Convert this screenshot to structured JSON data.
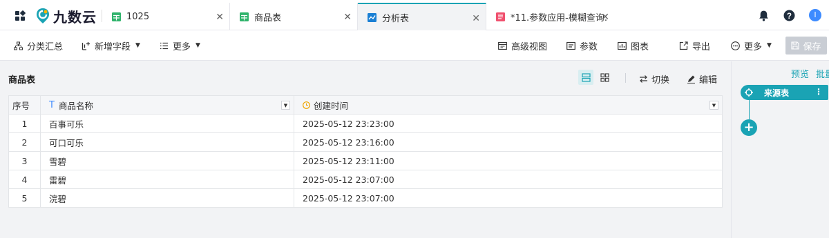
{
  "app": {
    "logo_text": "九数云"
  },
  "tabs": [
    {
      "label": "1025",
      "icon": "spreadsheet-icon",
      "color": "#2fb36b"
    },
    {
      "label": "商品表",
      "icon": "spreadsheet-icon",
      "color": "#2fb36b"
    },
    {
      "label": "分析表",
      "icon": "analysis-icon",
      "color": "#1aa3b4",
      "active": true
    },
    {
      "label": "*11.参数应用-模糊查询...",
      "icon": "document-icon",
      "color": "#f0506e"
    }
  ],
  "user": {
    "avatar_letter": "I"
  },
  "toolbar": {
    "group_summary": "分类汇总",
    "add_field": "新增字段",
    "more_left": "更多",
    "advanced_view": "高级视图",
    "params": "参数",
    "chart": "图表",
    "export": "导出",
    "more_right": "更多",
    "save": "保存"
  },
  "panel": {
    "title": "商品表",
    "switch_label": "切换",
    "edit_label": "编辑"
  },
  "table": {
    "headers": {
      "index": "序号",
      "name": "商品名称",
      "created": "创建时间"
    },
    "rows": [
      {
        "index": "1",
        "name": "百事可乐",
        "created": "2025-05-12 23:23:00"
      },
      {
        "index": "2",
        "name": "可口可乐",
        "created": "2025-05-12 23:16:00"
      },
      {
        "index": "3",
        "name": "雪碧",
        "created": "2025-05-12 23:11:00"
      },
      {
        "index": "4",
        "name": "雷碧",
        "created": "2025-05-12 23:07:00"
      },
      {
        "index": "5",
        "name": "浣碧",
        "created": "2025-05-12 23:07:00"
      }
    ]
  },
  "right_panel": {
    "preview": "预览",
    "batch": "批量",
    "source_node": "来源表"
  },
  "colors": {
    "accent": "#1aa3b4",
    "save_disabled": "#c9cdd4"
  }
}
